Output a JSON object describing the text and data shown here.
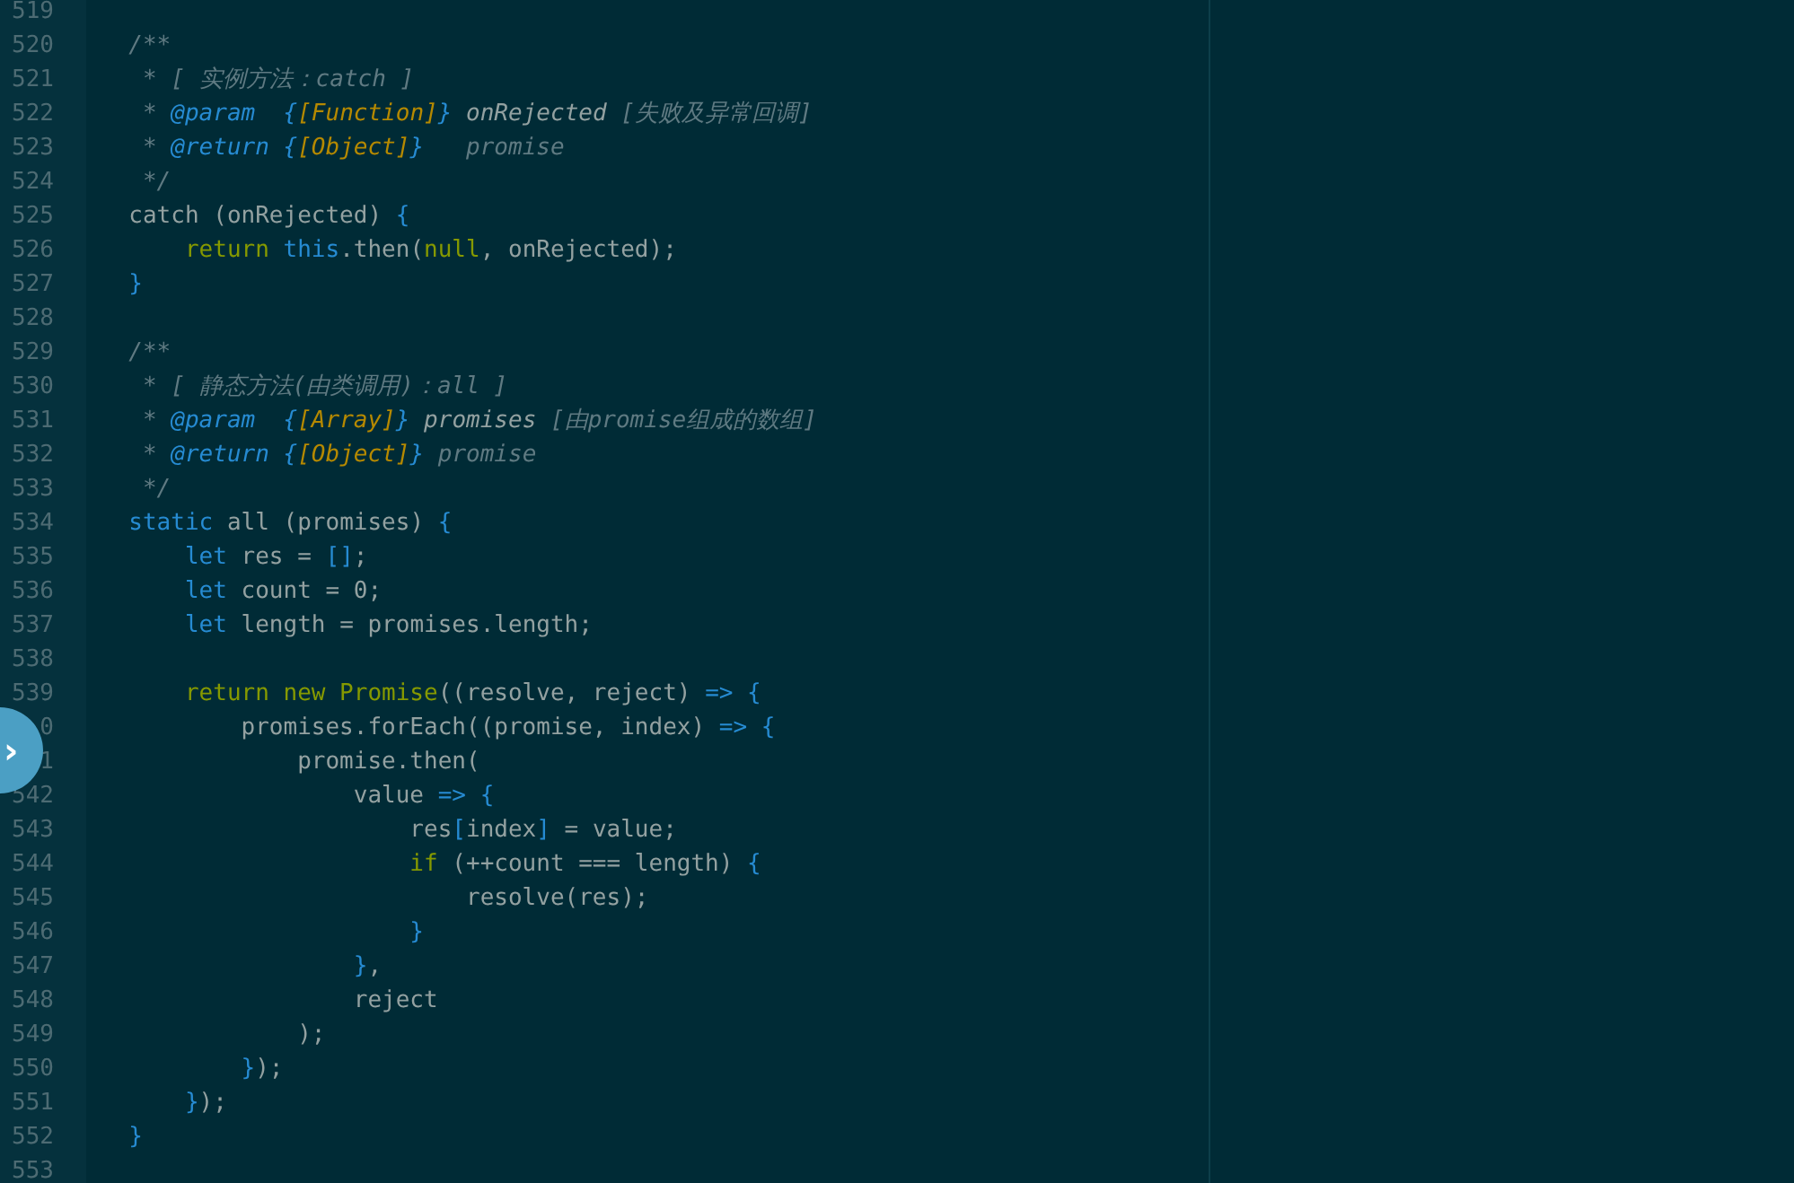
{
  "editor": {
    "lines": [
      {
        "number": "519"
      },
      {
        "number": "520",
        "tokens": [
          {
            "kind": "comment",
            "text": "  /**"
          }
        ]
      },
      {
        "number": "521",
        "tokens": [
          {
            "kind": "comment",
            "text": "   * [ 实例方法：catch ]"
          }
        ]
      },
      {
        "number": "522",
        "tokens": [
          {
            "kind": "comment",
            "text": "   * "
          },
          {
            "kind": "tag",
            "text": "@param  {"
          },
          {
            "kind": "type",
            "text": "[Function]"
          },
          {
            "kind": "tag",
            "text": "}"
          },
          {
            "kind": "comment-name",
            "text": " onRejected"
          },
          {
            "kind": "comment",
            "text": " [失败及异常回调]"
          }
        ]
      },
      {
        "number": "523",
        "tokens": [
          {
            "kind": "comment",
            "text": "   * "
          },
          {
            "kind": "tag",
            "text": "@return {"
          },
          {
            "kind": "type",
            "text": "[Object]"
          },
          {
            "kind": "tag",
            "text": "}"
          },
          {
            "kind": "comment",
            "text": "   promise"
          }
        ]
      },
      {
        "number": "524",
        "tokens": [
          {
            "kind": "comment",
            "text": "   */"
          }
        ]
      },
      {
        "number": "525",
        "tokens": [
          {
            "kind": "plain",
            "text": "  catch (onRejected) "
          },
          {
            "kind": "blue",
            "text": "{"
          }
        ]
      },
      {
        "number": "526",
        "tokens": [
          {
            "kind": "keyword",
            "text": "      return "
          },
          {
            "kind": "blue",
            "text": "this"
          },
          {
            "kind": "plain",
            "text": ".then("
          },
          {
            "kind": "keyword",
            "text": "null"
          },
          {
            "kind": "plain",
            "text": ", onRejected);"
          }
        ]
      },
      {
        "number": "527",
        "tokens": [
          {
            "kind": "blue",
            "text": "  }"
          }
        ]
      },
      {
        "number": "528"
      },
      {
        "number": "529",
        "tokens": [
          {
            "kind": "comment",
            "text": "  /**"
          }
        ]
      },
      {
        "number": "530",
        "tokens": [
          {
            "kind": "comment",
            "text": "   * [ 静态方法(由类调用)：all ]"
          }
        ]
      },
      {
        "number": "531",
        "tokens": [
          {
            "kind": "comment",
            "text": "   * "
          },
          {
            "kind": "tag",
            "text": "@param  {"
          },
          {
            "kind": "type",
            "text": "[Array]"
          },
          {
            "kind": "tag",
            "text": "}"
          },
          {
            "kind": "comment-name",
            "text": " promises"
          },
          {
            "kind": "comment",
            "text": " [由promise组成的数组]"
          }
        ]
      },
      {
        "number": "532",
        "tokens": [
          {
            "kind": "comment",
            "text": "   * "
          },
          {
            "kind": "tag",
            "text": "@return {"
          },
          {
            "kind": "type",
            "text": "[Object]"
          },
          {
            "kind": "tag",
            "text": "}"
          },
          {
            "kind": "comment",
            "text": " promise"
          }
        ]
      },
      {
        "number": "533",
        "tokens": [
          {
            "kind": "comment",
            "text": "   */"
          }
        ]
      },
      {
        "number": "534",
        "tokens": [
          {
            "kind": "blue",
            "text": "  static"
          },
          {
            "kind": "plain",
            "text": " all (promises) "
          },
          {
            "kind": "blue",
            "text": "{"
          }
        ]
      },
      {
        "number": "535",
        "tokens": [
          {
            "kind": "blue",
            "text": "      let"
          },
          {
            "kind": "plain",
            "text": " res = "
          },
          {
            "kind": "blue",
            "text": "[]"
          },
          {
            "kind": "plain",
            "text": ";"
          }
        ]
      },
      {
        "number": "536",
        "tokens": [
          {
            "kind": "blue",
            "text": "      let"
          },
          {
            "kind": "plain",
            "text": " count = 0;"
          }
        ]
      },
      {
        "number": "537",
        "tokens": [
          {
            "kind": "blue",
            "text": "      let"
          },
          {
            "kind": "plain",
            "text": " length = promises.length;"
          }
        ]
      },
      {
        "number": "538"
      },
      {
        "number": "539",
        "tokens": [
          {
            "kind": "keyword",
            "text": "      return new Promise"
          },
          {
            "kind": "plain",
            "text": "((resolve, reject) "
          },
          {
            "kind": "blue",
            "text": "=> {"
          }
        ]
      },
      {
        "number": "0",
        "tokens": [
          {
            "kind": "plain",
            "text": "          promises.forEach((promise, index) "
          },
          {
            "kind": "blue",
            "text": "=> {"
          }
        ]
      },
      {
        "number": "1",
        "tokens": [
          {
            "kind": "plain",
            "text": "              promise.then("
          }
        ]
      },
      {
        "number": "542",
        "tokens": [
          {
            "kind": "plain",
            "text": "                  value "
          },
          {
            "kind": "blue",
            "text": "=> {"
          }
        ]
      },
      {
        "number": "543",
        "tokens": [
          {
            "kind": "plain",
            "text": "                      res"
          },
          {
            "kind": "blue",
            "text": "["
          },
          {
            "kind": "plain",
            "text": "index"
          },
          {
            "kind": "blue",
            "text": "]"
          },
          {
            "kind": "plain",
            "text": " = value;"
          }
        ]
      },
      {
        "number": "544",
        "tokens": [
          {
            "kind": "keyword",
            "text": "                      if"
          },
          {
            "kind": "plain",
            "text": " (++count === length) "
          },
          {
            "kind": "blue",
            "text": "{"
          }
        ]
      },
      {
        "number": "545",
        "tokens": [
          {
            "kind": "plain",
            "text": "                          resolve(res);"
          }
        ]
      },
      {
        "number": "546",
        "tokens": [
          {
            "kind": "blue",
            "text": "                      }"
          }
        ]
      },
      {
        "number": "547",
        "tokens": [
          {
            "kind": "blue",
            "text": "                  }"
          },
          {
            "kind": "plain",
            "text": ","
          }
        ]
      },
      {
        "number": "548",
        "tokens": [
          {
            "kind": "plain",
            "text": "                  reject"
          }
        ]
      },
      {
        "number": "549",
        "tokens": [
          {
            "kind": "plain",
            "text": "              );"
          }
        ]
      },
      {
        "number": "550",
        "tokens": [
          {
            "kind": "blue",
            "text": "          }"
          },
          {
            "kind": "plain",
            "text": ");"
          }
        ]
      },
      {
        "number": "551",
        "tokens": [
          {
            "kind": "blue",
            "text": "      }"
          },
          {
            "kind": "plain",
            "text": ");"
          }
        ]
      },
      {
        "number": "552",
        "tokens": [
          {
            "kind": "blue",
            "text": "  }"
          }
        ]
      },
      {
        "number": "553"
      }
    ]
  },
  "side_toggle": {
    "glyph": "›"
  }
}
